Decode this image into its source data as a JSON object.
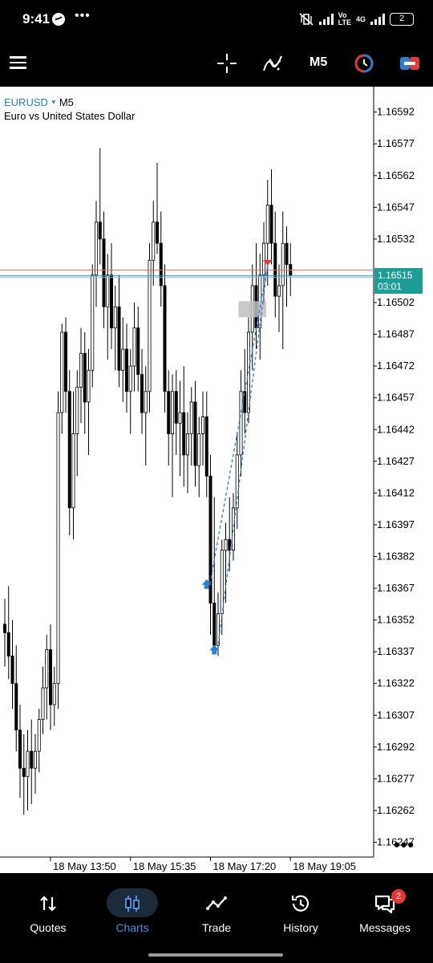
{
  "status_bar": {
    "time": "9:41",
    "network": "4G",
    "battery": "2",
    "overflow": "•••"
  },
  "toolbar": {
    "timeframe": "M5"
  },
  "chart": {
    "symbol": "EURUSD",
    "timeframe": "M5",
    "description": "Euro vs United States Dollar",
    "current_price": "1.16515",
    "countdown": "03:01",
    "more": "•••"
  },
  "chart_data": {
    "type": "candlestick",
    "title": "",
    "ylim": [
      1.1624,
      1.16604
    ],
    "y_ticks": [
      "1.16592",
      "1.16577",
      "1.16562",
      "1.16547",
      "1.16532",
      "1.16502",
      "1.16487",
      "1.16472",
      "1.16457",
      "1.16442",
      "1.16427",
      "1.16412",
      "1.16397",
      "1.16382",
      "1.16367",
      "1.16352",
      "1.16337",
      "1.16322",
      "1.16307",
      "1.16292",
      "1.16277",
      "1.16262",
      "1.16247"
    ],
    "x_ticks": [
      {
        "label": "18 May 13:50",
        "index": 12
      },
      {
        "label": "18 May 15:35",
        "index": 33
      },
      {
        "label": "18 May 17:20",
        "index": 54
      },
      {
        "label": "18 May 19:05",
        "index": 75
      }
    ],
    "bid_price": 1.16515,
    "ask_price": 1.16517,
    "candles": [
      [
        1.1635,
        1.16362,
        1.1633,
        1.16346
      ],
      [
        1.16346,
        1.16368,
        1.16324,
        1.16335
      ],
      [
        1.16335,
        1.16352,
        1.1631,
        1.16322
      ],
      [
        1.16322,
        1.1634,
        1.1629,
        1.163
      ],
      [
        1.163,
        1.16312,
        1.16268,
        1.16282
      ],
      [
        1.16282,
        1.16298,
        1.1626,
        1.16278
      ],
      [
        1.16278,
        1.163,
        1.16262,
        1.1629
      ],
      [
        1.1629,
        1.16305,
        1.16265,
        1.16282
      ],
      [
        1.16282,
        1.16298,
        1.1627,
        1.1629
      ],
      [
        1.1629,
        1.1631,
        1.1628,
        1.16305
      ],
      [
        1.16305,
        1.1633,
        1.16298,
        1.1632
      ],
      [
        1.1632,
        1.16345,
        1.16305,
        1.16338
      ],
      [
        1.16338,
        1.1635,
        1.163,
        1.16312
      ],
      [
        1.16312,
        1.1633,
        1.16302,
        1.16322
      ],
      [
        1.16322,
        1.1646,
        1.1631,
        1.1645
      ],
      [
        1.1645,
        1.16492,
        1.1644,
        1.16488
      ],
      [
        1.16488,
        1.16495,
        1.1645,
        1.1646
      ],
      [
        1.1646,
        1.1647,
        1.16392,
        1.16405
      ],
      [
        1.16405,
        1.1646,
        1.1639,
        1.1644
      ],
      [
        1.1644,
        1.1647,
        1.1642,
        1.16462
      ],
      [
        1.16462,
        1.1649,
        1.16445,
        1.16478
      ],
      [
        1.16478,
        1.16488,
        1.1644,
        1.16455
      ],
      [
        1.16455,
        1.1648,
        1.1643,
        1.1647
      ],
      [
        1.1647,
        1.1652,
        1.16462,
        1.16515
      ],
      [
        1.16515,
        1.1655,
        1.165,
        1.1654
      ],
      [
        1.1654,
        1.16575,
        1.1652,
        1.16532
      ],
      [
        1.16532,
        1.16545,
        1.1649,
        1.165
      ],
      [
        1.165,
        1.16525,
        1.16475,
        1.16515
      ],
      [
        1.16515,
        1.1653,
        1.1648,
        1.1649
      ],
      [
        1.1649,
        1.1651,
        1.1647,
        1.165
      ],
      [
        1.165,
        1.16515,
        1.16462,
        1.1647
      ],
      [
        1.1647,
        1.16495,
        1.16455,
        1.1648
      ],
      [
        1.1648,
        1.16492,
        1.1645,
        1.1646
      ],
      [
        1.1646,
        1.1648,
        1.1644,
        1.16472
      ],
      [
        1.16472,
        1.16502,
        1.1646,
        1.1649
      ],
      [
        1.1649,
        1.165,
        1.1646,
        1.16468
      ],
      [
        1.16468,
        1.1648,
        1.1644,
        1.1645
      ],
      [
        1.1645,
        1.16472,
        1.16425,
        1.1646
      ],
      [
        1.1646,
        1.1653,
        1.1645,
        1.16522
      ],
      [
        1.16522,
        1.1655,
        1.1651,
        1.1654
      ],
      [
        1.1654,
        1.16568,
        1.16525,
        1.1653
      ],
      [
        1.1653,
        1.16545,
        1.165,
        1.1651
      ],
      [
        1.1651,
        1.1652,
        1.1645,
        1.1646
      ],
      [
        1.1646,
        1.1647,
        1.16425,
        1.1644
      ],
      [
        1.1644,
        1.16468,
        1.1641,
        1.1646
      ],
      [
        1.1646,
        1.1647,
        1.1643,
        1.16445
      ],
      [
        1.16445,
        1.16465,
        1.1642,
        1.1645
      ],
      [
        1.1645,
        1.16472,
        1.16415,
        1.1643
      ],
      [
        1.1643,
        1.1645,
        1.16412,
        1.1644
      ],
      [
        1.1644,
        1.16462,
        1.16425,
        1.16455
      ],
      [
        1.16455,
        1.16465,
        1.16415,
        1.16425
      ],
      [
        1.16425,
        1.16448,
        1.1641,
        1.1644
      ],
      [
        1.1644,
        1.1646,
        1.16425,
        1.16448
      ],
      [
        1.16448,
        1.1646,
        1.1641,
        1.1642
      ],
      [
        1.1642,
        1.1643,
        1.16345,
        1.1636
      ],
      [
        1.1636,
        1.1641,
        1.16336,
        1.1634
      ],
      [
        1.1634,
        1.16365,
        1.16335,
        1.16355
      ],
      [
        1.16355,
        1.1639,
        1.16345,
        1.16385
      ],
      [
        1.16385,
        1.16398,
        1.1636,
        1.1639
      ],
      [
        1.1639,
        1.1641,
        1.16375,
        1.16385
      ],
      [
        1.16385,
        1.16412,
        1.1638,
        1.16405
      ],
      [
        1.16405,
        1.1644,
        1.16395,
        1.1643
      ],
      [
        1.1643,
        1.1647,
        1.1642,
        1.1646
      ],
      [
        1.1646,
        1.1648,
        1.1644,
        1.1645
      ],
      [
        1.1645,
        1.16495,
        1.16445,
        1.16488
      ],
      [
        1.16488,
        1.1652,
        1.1647,
        1.1651
      ],
      [
        1.1651,
        1.1653,
        1.1648,
        1.1649
      ],
      [
        1.1649,
        1.16525,
        1.16475,
        1.16515
      ],
      [
        1.16515,
        1.1654,
        1.165,
        1.1653
      ],
      [
        1.1653,
        1.1656,
        1.1651,
        1.16548
      ],
      [
        1.16548,
        1.16565,
        1.1652,
        1.1653
      ],
      [
        1.1653,
        1.16545,
        1.16495,
        1.16505
      ],
      [
        1.16505,
        1.1652,
        1.16488,
        1.1651
      ],
      [
        1.1651,
        1.16545,
        1.1648,
        1.1653
      ],
      [
        1.1653,
        1.16538,
        1.165,
        1.1652
      ],
      [
        1.1652,
        1.1653,
        1.16505,
        1.16515
      ]
    ],
    "trades": [
      {
        "type": "buy",
        "index": 55,
        "price": 1.16338
      },
      {
        "type": "buy",
        "index": 53,
        "price": 1.16369
      },
      {
        "type": "sell",
        "index": 69,
        "price": 1.16521
      }
    ],
    "marker_box": {
      "index_start": 62,
      "index_end": 68,
      "high": 1.165,
      "low": 1.16492
    },
    "grid": false,
    "colors": {
      "candle": "#000000",
      "bid_line": "#2a9d8f",
      "ask_line": "#e57373",
      "buy": "#2a7fd4",
      "sell": "#e53935",
      "price_tag": "#1d9e95"
    }
  },
  "nav": [
    {
      "label": "Quotes",
      "icon": "quotes-icon"
    },
    {
      "label": "Charts",
      "icon": "charts-icon",
      "active": true
    },
    {
      "label": "Trade",
      "icon": "trade-icon"
    },
    {
      "label": "History",
      "icon": "history-icon"
    },
    {
      "label": "Messages",
      "icon": "messages-icon",
      "badge": "2"
    }
  ]
}
